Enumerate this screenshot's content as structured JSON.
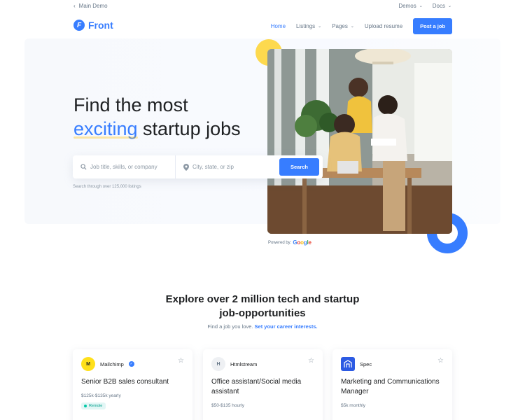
{
  "topbar": {
    "back_label": "Main Demo",
    "demos_label": "Demos",
    "docs_label": "Docs"
  },
  "navbar": {
    "logo_text": "Front",
    "home": "Home",
    "listings": "Listings",
    "pages": "Pages",
    "upload_resume": "Upload resume",
    "post_job": "Post a job"
  },
  "hero": {
    "title_line1": "Find the most",
    "title_accent": "exciting",
    "title_rest": " startup jobs",
    "job_placeholder": "Job title, skills, or company",
    "location_placeholder": "City, state, or zip",
    "search_button": "Search",
    "hint": "Search through over 125,000 listings",
    "powered_by": "Powered by:",
    "google": "Google"
  },
  "section": {
    "title": "Explore over 2 million tech and startup job-opportunities",
    "subtitle": "Find a job you love.",
    "subtitle_link": "Set your career interests."
  },
  "cards": [
    {
      "company": "Mailchimp",
      "title": "Senior B2B sales consultant",
      "salary": "$125k-$135k yearly",
      "badge": "Remote",
      "logo": "M"
    },
    {
      "company": "Htmlstream",
      "title": "Office assistant/Social media assistant",
      "salary": "$50-$135 hourly",
      "logo": "H"
    },
    {
      "company": "Spec",
      "title": "Marketing and Communications Manager",
      "salary": "$5k monthly"
    }
  ],
  "colors": {
    "accent": "#377dff",
    "yellow": "#fdd94e",
    "teal": "#00c9a7"
  }
}
